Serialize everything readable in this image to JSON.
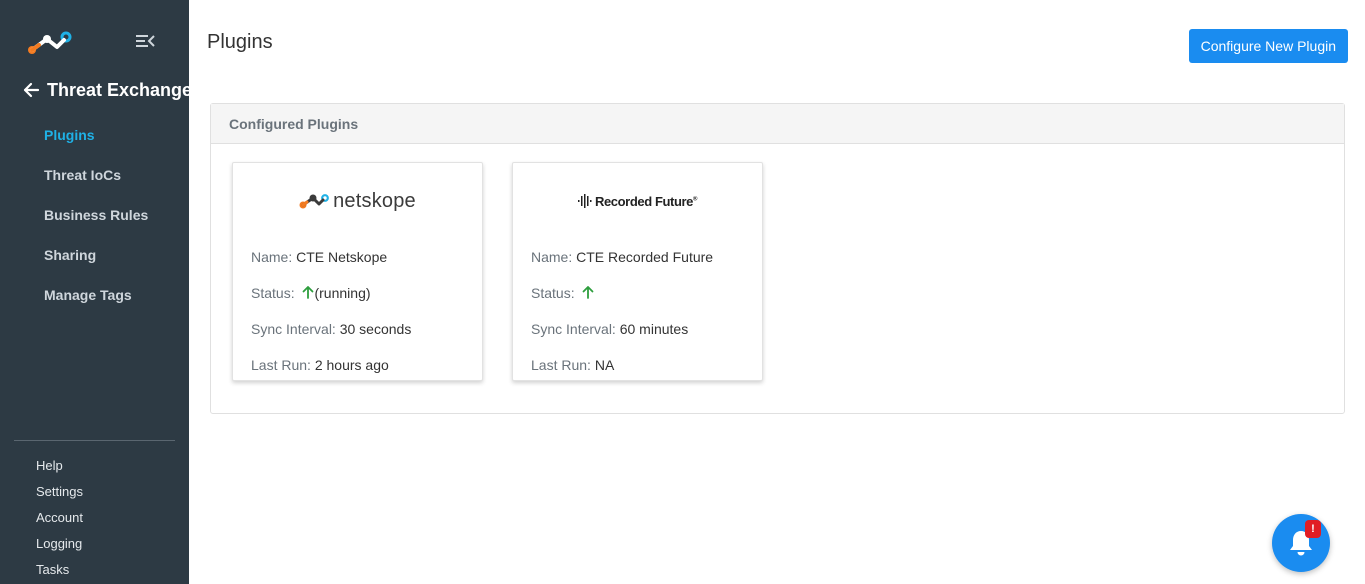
{
  "sidebar": {
    "logo_icon": "netskope-logo-icon",
    "collapse_icon": "menu-collapse-icon",
    "section_title": "Threat Exchange",
    "back_icon": "arrow-left-icon",
    "items": [
      {
        "label": "Plugins",
        "active": true
      },
      {
        "label": "Threat IoCs",
        "active": false
      },
      {
        "label": "Business Rules",
        "active": false
      },
      {
        "label": "Sharing",
        "active": false
      },
      {
        "label": "Manage Tags",
        "active": false
      }
    ],
    "footer_items": [
      {
        "label": "Help"
      },
      {
        "label": "Settings"
      },
      {
        "label": "Account"
      },
      {
        "label": "Logging"
      },
      {
        "label": "Tasks"
      }
    ]
  },
  "header": {
    "title": "Plugins",
    "configure_button_label": "Configure New Plugin"
  },
  "panel": {
    "title": "Configured Plugins"
  },
  "plugins": [
    {
      "logo_text": "netskope",
      "name_label": "Name:",
      "name": "CTE Netskope",
      "status_label": "Status:",
      "status_text": "(running)",
      "status_icon": "arrow-up-icon",
      "sync_label": "Sync Interval:",
      "sync_interval": "30 seconds",
      "last_run_label": "Last Run:",
      "last_run": "2 hours ago"
    },
    {
      "logo_text": "Recorded Future",
      "logo_mark": "®",
      "name_label": "Name:",
      "name": "CTE Recorded Future",
      "status_label": "Status:",
      "status_text": "",
      "status_icon": "arrow-up-icon",
      "sync_label": "Sync Interval:",
      "sync_interval": "60 minutes",
      "last_run_label": "Last Run:",
      "last_run": "NA"
    }
  ],
  "notifications": {
    "icon": "bell-icon",
    "badge": "!"
  },
  "colors": {
    "sidebar_bg": "#2d3a44",
    "active_nav": "#1fb1e6",
    "primary": "#1a8cf0",
    "status_up": "#2e9e3e",
    "badge": "#e11d24",
    "netskope_orange": "#f47b20",
    "netskope_blue": "#1fb1e6"
  }
}
